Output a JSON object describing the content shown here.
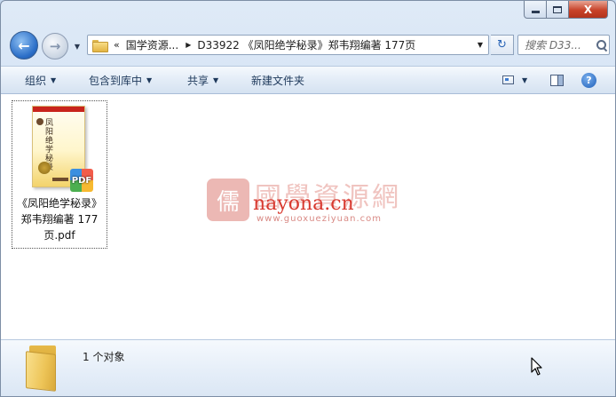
{
  "window": {
    "caption": {
      "close_label": "X"
    }
  },
  "nav": {
    "back_icon": "back-arrow-icon",
    "forward_icon": "forward-arrow-icon",
    "overflow_chevron": "«",
    "breadcrumbs": [
      "国学资源...",
      "D33922 《凤阳绝学秘录》郑韦翔编著 177页"
    ],
    "search_placeholder": "搜索 D33..."
  },
  "toolbar": {
    "organize": "组织",
    "include_library": "包含到库中",
    "share": "共享",
    "new_folder": "新建文件夹"
  },
  "files": [
    {
      "name": "《凤阳绝学秘录》郑韦翔编著 177页.pdf",
      "type": "pdf",
      "badge": "PDF",
      "thumb_title": "凤阳绝学秘录"
    }
  ],
  "watermark": {
    "logo_glyph": "儒",
    "cn": "國學資源網",
    "en": "nayona.cn",
    "url": "www.guoxueziyuan.com"
  },
  "details": {
    "count": "1 个对象"
  },
  "colors": {
    "accent": "#2c6fc8",
    "close": "#c8432a",
    "watermark_red": "#d83a30"
  }
}
